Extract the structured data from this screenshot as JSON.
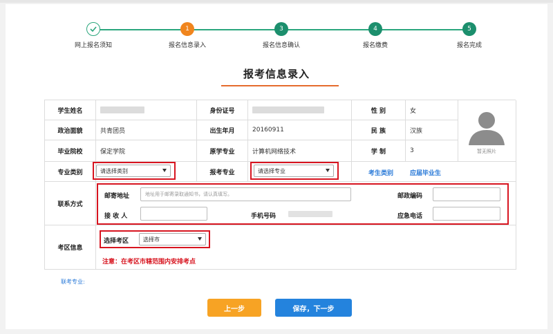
{
  "steps": [
    {
      "label": "网上报名须知",
      "number": "",
      "state": "done"
    },
    {
      "label": "报名信息录入",
      "number": "1",
      "state": "active"
    },
    {
      "label": "报名信息确认",
      "number": "3",
      "state": "todo"
    },
    {
      "label": "报名缴费",
      "number": "4",
      "state": "todo"
    },
    {
      "label": "报名完成",
      "number": "5",
      "state": "todo"
    }
  ],
  "page_title": "报考信息录入",
  "info": {
    "name_label": "学生姓名",
    "id_label": "身份证号",
    "gender_label": "性  别",
    "gender_value": "女",
    "politics_label": "政治面貌",
    "politics_value": "共青团员",
    "birth_label": "出生年月",
    "birth_value": "20160911",
    "nation_label": "民  族",
    "nation_value": "汉族",
    "school_label": "毕业院校",
    "school_value": "保定学院",
    "orig_major_label": "原学专业",
    "orig_major_value": "计算机网络技术",
    "system_label": "学  制",
    "system_value": "3",
    "photo_placeholder": "暂无照片"
  },
  "major": {
    "category_label": "专业类别",
    "category_select": "请选择类别",
    "apply_label": "报考专业",
    "apply_select": "请选择专业",
    "exam_type_link": "考生类别",
    "graduate_link": "应届毕业生"
  },
  "contact": {
    "section_label": "联系方式",
    "address_label": "邮寄地址",
    "address_placeholder": "地址用于邮寄录取通知书，请认真填写。",
    "postcode_label": "邮政编码",
    "recipient_label": "接 收 人",
    "mobile_label": "手机号码",
    "emergency_label": "应急电话"
  },
  "exam_area": {
    "section_label": "考区信息",
    "select_label": "选择考区",
    "select_value": "选择市",
    "note": "注意：在考区市辖范围内安排考点"
  },
  "joint_major": "联考专业:",
  "buttons": {
    "prev": "上一步",
    "next": "保存，下一步"
  },
  "colors": {
    "step_done": "#2aa67c",
    "step_active": "#f0851e",
    "highlight_border": "#d7141f",
    "link": "#2a7ad8",
    "btn_prev": "#f7a324",
    "btn_next": "#2483dd"
  }
}
